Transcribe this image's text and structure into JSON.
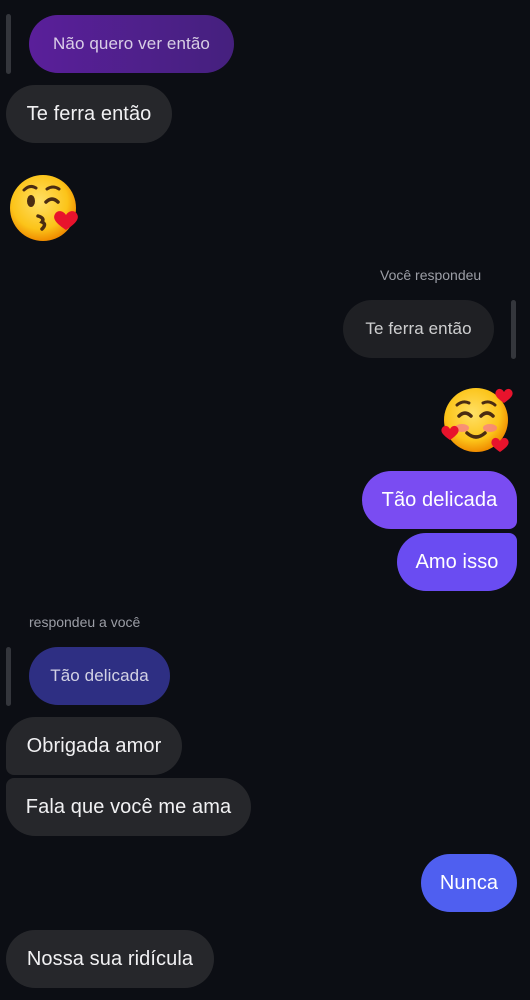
{
  "colors": {
    "background": "#0c0e14",
    "incoming_bubble": "#26272b",
    "outgoing_purple": "#7a4cf2",
    "outgoing_blue": "#4f5ff0",
    "reply_quote_purple": "#4a1f88",
    "reply_quote_indigo": "#2e2f83"
  },
  "messages": {
    "quote_top": {
      "text": "Não quero ver então"
    },
    "m1": {
      "text": "Te ferra então"
    },
    "emoji1": {
      "icon": "kissing-face-with-heart-emoji"
    },
    "reply_label_me": {
      "text": "Você respondeu"
    },
    "quote_me": {
      "text": "Te ferra então"
    },
    "emoji2": {
      "icon": "smiling-face-with-hearts-emoji"
    },
    "m2": {
      "text": "Tão delicada"
    },
    "m3": {
      "text": "Amo isso"
    },
    "reply_label_them": {
      "text": "respondeu a você"
    },
    "quote_them": {
      "text": "Tão delicada"
    },
    "m4": {
      "text": "Obrigada amor"
    },
    "m5": {
      "text": "Fala que você me ama"
    },
    "m6": {
      "text": "Nunca"
    },
    "m7": {
      "text": "Nossa sua ridícula"
    }
  }
}
